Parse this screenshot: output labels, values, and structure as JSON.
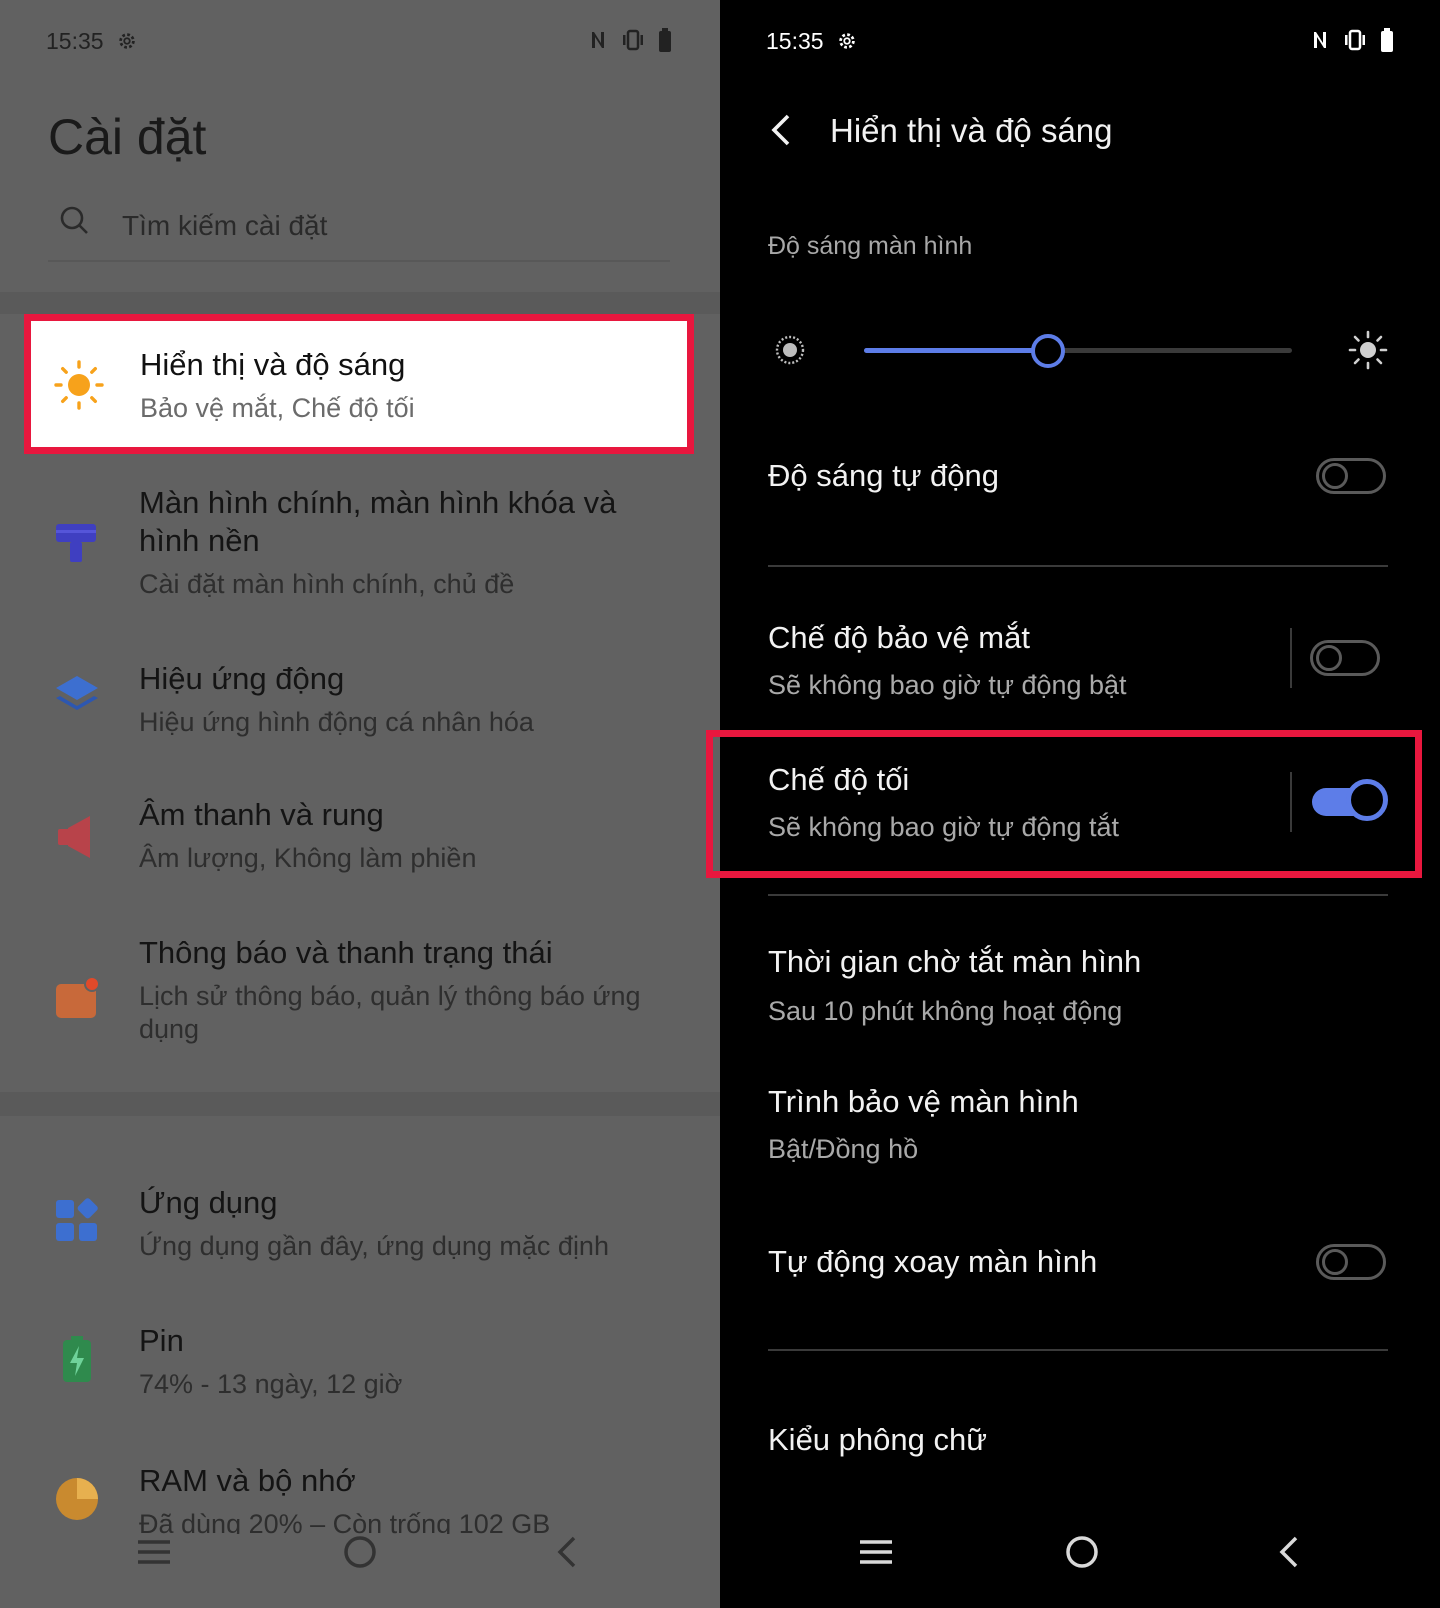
{
  "left": {
    "status": {
      "time": "15:35"
    },
    "title": "Cài đặt",
    "search": {
      "placeholder": "Tìm kiếm cài đặt"
    },
    "highlighted": {
      "title": "Hiển thị và độ sáng",
      "subtitle": "Bảo vệ mắt, Chế độ tối",
      "icon": "sun-icon"
    },
    "items": [
      {
        "title": "Màn hình chính, màn hình khóa và hình nền",
        "subtitle": "Cài đặt màn hình chính, chủ đề",
        "icon": "home-screen-icon",
        "color": "#3f3fc1"
      },
      {
        "title": "Hiệu ứng động",
        "subtitle": "Hiệu ứng hình động cá nhân hóa",
        "icon": "layers-icon",
        "color": "#3d6fd0"
      },
      {
        "title": "Âm thanh và rung",
        "subtitle": "Âm lượng, Không làm phiền",
        "icon": "speaker-icon",
        "color": "#b8434a"
      },
      {
        "title": "Thông báo và thanh trạng thái",
        "subtitle": "Lịch sử thông báo, quản lý thông báo ứng dụng",
        "icon": "notification-icon",
        "color": "#c8693a"
      },
      {
        "title": "Ứng dụng",
        "subtitle": "Ứng dụng gần đây, ứng dụng mặc định",
        "icon": "apps-icon",
        "color": "#3d6fd0"
      },
      {
        "title": "Pin",
        "subtitle": "74% - 13 ngày, 12 giờ",
        "icon": "battery-icon",
        "color": "#2f8a4d"
      },
      {
        "title": "RAM và bộ nhớ",
        "subtitle": "Đã dùng 20% – Còn trống 102 GB",
        "icon": "storage-pie-icon",
        "color": "#c98a2f"
      }
    ]
  },
  "right": {
    "status": {
      "time": "15:35"
    },
    "header_title": "Hiển thị và độ sáng",
    "brightness_label": "Độ sáng màn hình",
    "brightness_level": 0.43,
    "auto_brightness": {
      "title": "Độ sáng tự động",
      "on": false
    },
    "eye_protection": {
      "title": "Chế độ bảo vệ mắt",
      "subtitle": "Sẽ không bao giờ tự động bật",
      "on": false
    },
    "dark_mode": {
      "title": "Chế độ tối",
      "subtitle": "Sẽ không bao giờ tự động tắt",
      "on": true
    },
    "screen_timeout": {
      "title": "Thời gian chờ tắt màn hình",
      "subtitle": "Sau 10 phút không hoạt động"
    },
    "screensaver": {
      "title": "Trình bảo vệ màn hình",
      "subtitle": "Bật/Đồng hồ"
    },
    "auto_rotate": {
      "title": "Tự động xoay màn hình",
      "on": false
    },
    "font_style": {
      "title": "Kiểu phông chữ"
    }
  },
  "colors": {
    "accent": "#5d7de8",
    "highlight": "#e8173e"
  }
}
